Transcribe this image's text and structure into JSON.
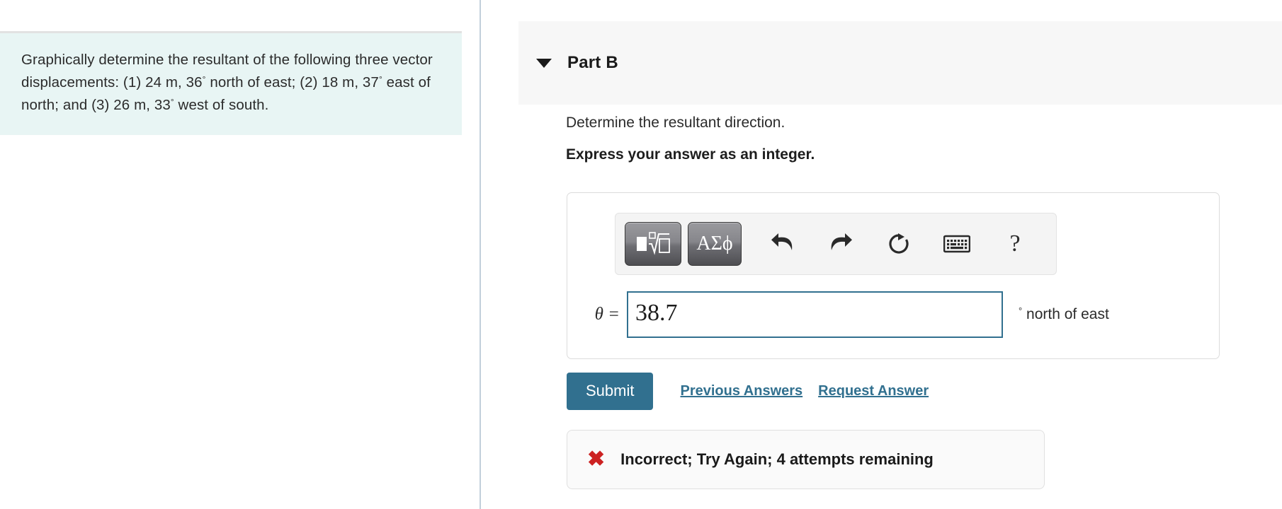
{
  "problem": {
    "text_parts": [
      "Graphically determine the resultant of the following three vector displacements: (1) 24 m, 36",
      "°",
      " north of east; (2) 18 m, 37",
      "°",
      " east of north; and (3) 26 m, 33",
      "°",
      " west of south."
    ],
    "full_text": "Graphically determine the resultant of the following three vector displacements: (1) 24 m, 36° north of east; (2) 18 m, 37° east of north; and (3) 26 m, 33° west of south.",
    "background_color": "#e8f5f4",
    "segments": {
      "lead": "Graphically determine the resultant of the following three vector displacements: (1) 24 m, 36",
      "mid1": " north of east; (2) 18 m, 37",
      "mid2": " east of north; and (3) 26 m, 33",
      "tail": " west of south.",
      "degree": "°"
    }
  },
  "part": {
    "title": "Part B",
    "collapse_icon": "triangle-down-icon",
    "header_background": "#f7f7f7"
  },
  "question": {
    "prompt": "Determine the resultant direction.",
    "format_note": "Express your answer as an integer."
  },
  "math_toolbar": {
    "buttons": [
      {
        "name": "math-template-button",
        "icon": "square-root-template-icon",
        "label": ""
      },
      {
        "name": "greek-letters-button",
        "icon": "greek-letters-icon",
        "label": "ΑΣϕ"
      },
      {
        "name": "undo-button",
        "icon": "undo-arrow-icon",
        "label": ""
      },
      {
        "name": "redo-button",
        "icon": "redo-arrow-icon",
        "label": ""
      },
      {
        "name": "reset-button",
        "icon": "reset-circular-arrow-icon",
        "label": ""
      },
      {
        "name": "keyboard-button",
        "icon": "keyboard-icon",
        "label": ""
      },
      {
        "name": "help-button",
        "icon": "question-mark-icon",
        "label": "?"
      }
    ],
    "greek_label": "ΑΣϕ",
    "help_label": "?"
  },
  "answer": {
    "variable_label": "θ =",
    "value": "38.7",
    "placeholder": "",
    "degree_symbol": "°",
    "unit_text": "north of east",
    "input_border_color": "#31708f"
  },
  "actions": {
    "submit_label": "Submit",
    "previous_answers_label": "Previous Answers",
    "request_answer_label": "Request Answer",
    "accent_color": "#31708f"
  },
  "feedback": {
    "icon": "red-x-icon",
    "icon_glyph": "✖",
    "message": "Incorrect; Try Again; 4 attempts remaining",
    "attempts_remaining": 4,
    "icon_color": "#cc2222"
  }
}
